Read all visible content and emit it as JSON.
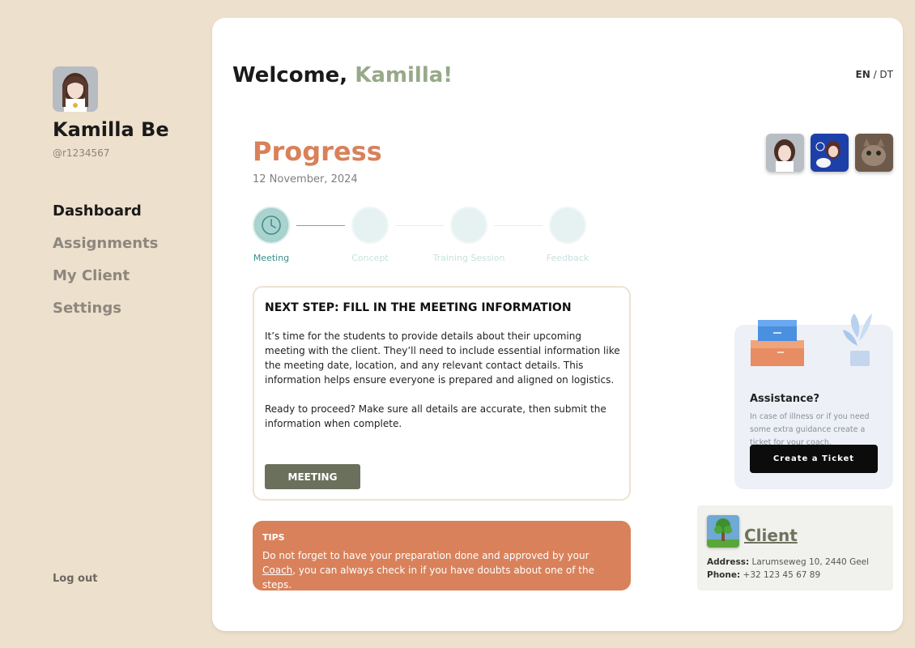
{
  "user": {
    "name": "Kamilla Be",
    "handle": "@r1234567"
  },
  "nav": {
    "items": [
      {
        "label": "Dashboard",
        "active": true
      },
      {
        "label": "Assignments",
        "active": false
      },
      {
        "label": "My Client",
        "active": false
      },
      {
        "label": "Settings",
        "active": false
      }
    ],
    "logout_label": "Log out"
  },
  "header": {
    "welcome_prefix": "Welcome, ",
    "welcome_name": "Kamilla!",
    "lang_en": "EN",
    "lang_sep": " / ",
    "lang_dt": "DT"
  },
  "progress": {
    "title": "Progress",
    "date": "12 November, 2024",
    "steps": [
      {
        "label": "Meeting",
        "active": true,
        "icon": "clock-icon"
      },
      {
        "label": "Concept",
        "active": false
      },
      {
        "label": "Training Session",
        "active": false
      },
      {
        "label": "Feedback",
        "active": false
      }
    ]
  },
  "next_step": {
    "title": "NEXT STEP: FILL IN THE MEETING INFORMATION",
    "paragraph1": "It’s time for the students to provide details about their upcoming meeting with the client. They’ll need to include essential information like the meeting date, location, and any relevant contact details. This information helps ensure everyone is prepared and aligned on logistics.",
    "paragraph2": "Ready to proceed? Make sure all details are accurate, then submit the information when complete.",
    "button_label": "MEETING"
  },
  "tips": {
    "title": "TIPS",
    "text_before": "Do not forget to have your preparation done and approved by your ",
    "link_label": "Coach",
    "text_after": ", you can always check in if you have doubts about one of the steps."
  },
  "assistance": {
    "title": "Assistance?",
    "text": "In case of illness or if you need some extra guidance create a ticket for your coach.",
    "button_label": "Create a Ticket"
  },
  "client": {
    "title": "Client",
    "address_label": "Address:",
    "address": " Larumseweg 10, 2440 Geel",
    "phone_label": "Phone:",
    "phone": " +32 123 45 67 89"
  },
  "colors": {
    "background": "#ede0cc",
    "accent_orange": "#d9815a",
    "accent_green": "#97a98a",
    "button_olive": "#6b705c",
    "step_teal": "#aad3cf"
  }
}
